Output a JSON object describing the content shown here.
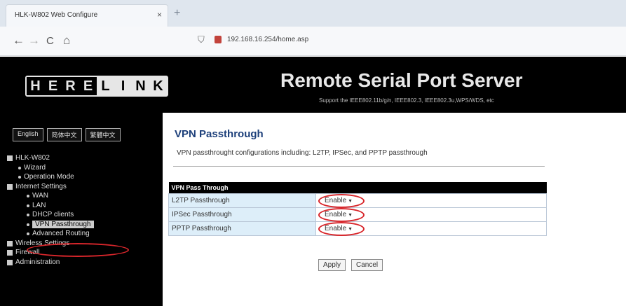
{
  "browser": {
    "tab_title": "HLK-W802 Web Configure",
    "tab_close": "×",
    "new_tab": "+",
    "back": "←",
    "forward": "→",
    "reload": "C",
    "home": "⌂",
    "url": "192.168.16.254/home.asp"
  },
  "header": {
    "logo_letters": [
      "H",
      "E",
      "R",
      "E",
      "L",
      "I",
      "N",
      "K"
    ],
    "title": "Remote Serial Port Server",
    "subtitle": "Support the IEEE802.11b/g/n, IEEE802.3, IEEE802.3u,WPS/WDS, etc"
  },
  "sidebar": {
    "lang_buttons": [
      "English",
      "简体中文",
      "繁體中文"
    ],
    "tree": [
      {
        "label": "HLK-W802",
        "level": 0
      },
      {
        "label": "Wizard",
        "level": 1
      },
      {
        "label": "Operation Mode",
        "level": 1
      },
      {
        "label": "Internet Settings",
        "level": 0
      },
      {
        "label": "WAN",
        "level": 2
      },
      {
        "label": "LAN",
        "level": 2
      },
      {
        "label": "DHCP clients",
        "level": 2
      },
      {
        "label": "VPN Passthrough",
        "level": 2,
        "selected": true
      },
      {
        "label": "Advanced Routing",
        "level": 2
      },
      {
        "label": "Wireless Settings",
        "level": 0
      },
      {
        "label": "Firewall",
        "level": 0
      },
      {
        "label": "Administration",
        "level": 0
      }
    ]
  },
  "main": {
    "title": "VPN Passthrough",
    "description": "VPN passthrought configurations including: L2TP, IPSec, and PPTP passthrough",
    "table": {
      "header": "VPN Pass Through",
      "rows": [
        {
          "label": "L2TP Passthrough",
          "value": "Enable"
        },
        {
          "label": "IPSec Passthrough",
          "value": "Enable"
        },
        {
          "label": "PPTP Passthrough",
          "value": "Enable"
        }
      ]
    },
    "apply_label": "Apply",
    "cancel_label": "Cancel"
  }
}
